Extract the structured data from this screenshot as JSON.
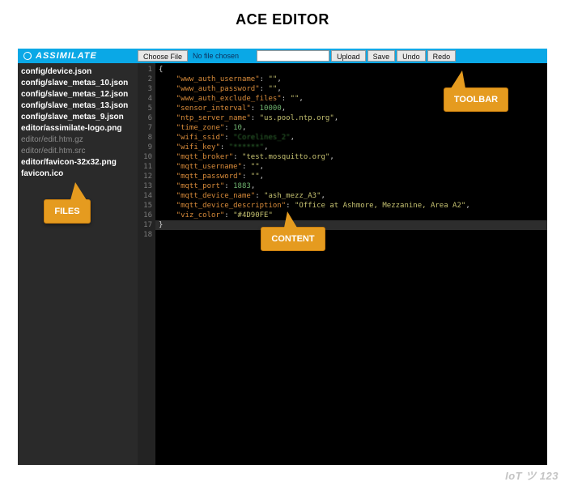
{
  "page_title": "ACE EDITOR",
  "brand": "ASSIMILATE",
  "toolbar": {
    "choose_file": "Choose File",
    "no_file": "No file chosen",
    "upload": "Upload",
    "save": "Save",
    "undo": "Undo",
    "redo": "Redo",
    "search_value": ""
  },
  "files": [
    {
      "name": "config/device.json",
      "dim": false
    },
    {
      "name": "config/slave_metas_10.json",
      "dim": false
    },
    {
      "name": "config/slave_metas_12.json",
      "dim": false
    },
    {
      "name": "config/slave_metas_13.json",
      "dim": false
    },
    {
      "name": "config/slave_metas_9.json",
      "dim": false
    },
    {
      "name": "editor/assimilate-logo.png",
      "dim": false
    },
    {
      "name": "editor/edit.htm.gz",
      "dim": true
    },
    {
      "name": "editor/edit.htm.src",
      "dim": true
    },
    {
      "name": "editor/favicon-32x32.png",
      "dim": false
    },
    {
      "name": "favicon.ico",
      "dim": false
    }
  ],
  "code_lines": [
    [
      {
        "t": "{",
        "c": "k-brace"
      }
    ],
    [
      {
        "t": "    \"www_auth_username\"",
        "c": "k-key"
      },
      {
        "t": ": ",
        "c": ""
      },
      {
        "t": "\"\"",
        "c": "k-str"
      },
      {
        "t": ",",
        "c": ""
      }
    ],
    [
      {
        "t": "    \"www_auth_password\"",
        "c": "k-key"
      },
      {
        "t": ": ",
        "c": ""
      },
      {
        "t": "\"\"",
        "c": "k-str"
      },
      {
        "t": ",",
        "c": ""
      }
    ],
    [
      {
        "t": "    \"www_auth_exclude_files\"",
        "c": "k-key"
      },
      {
        "t": ": ",
        "c": ""
      },
      {
        "t": "\"\"",
        "c": "k-str"
      },
      {
        "t": ",",
        "c": ""
      }
    ],
    [
      {
        "t": "    \"sensor_interval\"",
        "c": "k-key"
      },
      {
        "t": ": ",
        "c": ""
      },
      {
        "t": "10000",
        "c": "k-num"
      },
      {
        "t": ",",
        "c": ""
      }
    ],
    [
      {
        "t": "    \"ntp_server_name\"",
        "c": "k-key"
      },
      {
        "t": ": ",
        "c": ""
      },
      {
        "t": "\"us.pool.ntp.org\"",
        "c": "k-str"
      },
      {
        "t": ",",
        "c": ""
      }
    ],
    [
      {
        "t": "    \"time_zone\"",
        "c": "k-key"
      },
      {
        "t": ": ",
        "c": ""
      },
      {
        "t": "10",
        "c": "k-num"
      },
      {
        "t": ",",
        "c": ""
      }
    ],
    [
      {
        "t": "    \"wifi_ssid\"",
        "c": "k-key"
      },
      {
        "t": ": ",
        "c": ""
      },
      {
        "t": "\"Corelines_2\"",
        "c": "k-blur"
      },
      {
        "t": ",",
        "c": ""
      }
    ],
    [
      {
        "t": "    \"wifi_key\"",
        "c": "k-key"
      },
      {
        "t": ": ",
        "c": ""
      },
      {
        "t": "\"******\"",
        "c": "k-blur"
      },
      {
        "t": ",",
        "c": ""
      }
    ],
    [
      {
        "t": "    \"mqtt_broker\"",
        "c": "k-key"
      },
      {
        "t": ": ",
        "c": ""
      },
      {
        "t": "\"test.mosquitto.org\"",
        "c": "k-str"
      },
      {
        "t": ",",
        "c": ""
      }
    ],
    [
      {
        "t": "    \"mqtt_username\"",
        "c": "k-key"
      },
      {
        "t": ": ",
        "c": ""
      },
      {
        "t": "\"\"",
        "c": "k-str"
      },
      {
        "t": ",",
        "c": ""
      }
    ],
    [
      {
        "t": "    \"mqtt_password\"",
        "c": "k-key"
      },
      {
        "t": ": ",
        "c": ""
      },
      {
        "t": "\"\"",
        "c": "k-str"
      },
      {
        "t": ",",
        "c": ""
      }
    ],
    [
      {
        "t": "    \"mqtt_port\"",
        "c": "k-key"
      },
      {
        "t": ": ",
        "c": ""
      },
      {
        "t": "1883",
        "c": "k-num"
      },
      {
        "t": ",",
        "c": ""
      }
    ],
    [
      {
        "t": "    \"mqtt_device_name\"",
        "c": "k-key"
      },
      {
        "t": ": ",
        "c": ""
      },
      {
        "t": "\"ash_mezz_A3\"",
        "c": "k-str"
      },
      {
        "t": ",",
        "c": ""
      }
    ],
    [
      {
        "t": "    \"mqtt_device_description\"",
        "c": "k-key"
      },
      {
        "t": ": ",
        "c": ""
      },
      {
        "t": "\"Office at Ashmore, Mezzanine, Area A2\"",
        "c": "k-str"
      },
      {
        "t": ",",
        "c": ""
      }
    ],
    [
      {
        "t": "    \"viz_color\"",
        "c": "k-key"
      },
      {
        "t": ": ",
        "c": ""
      },
      {
        "t": "\"#4D90FE\"",
        "c": "k-str"
      }
    ],
    [
      {
        "t": "}",
        "c": "k-brace"
      }
    ]
  ],
  "callouts": {
    "files": "FILES",
    "content": "CONTENT",
    "toolbar": "TOOLBAR"
  },
  "watermark": "IoT ツ 123"
}
